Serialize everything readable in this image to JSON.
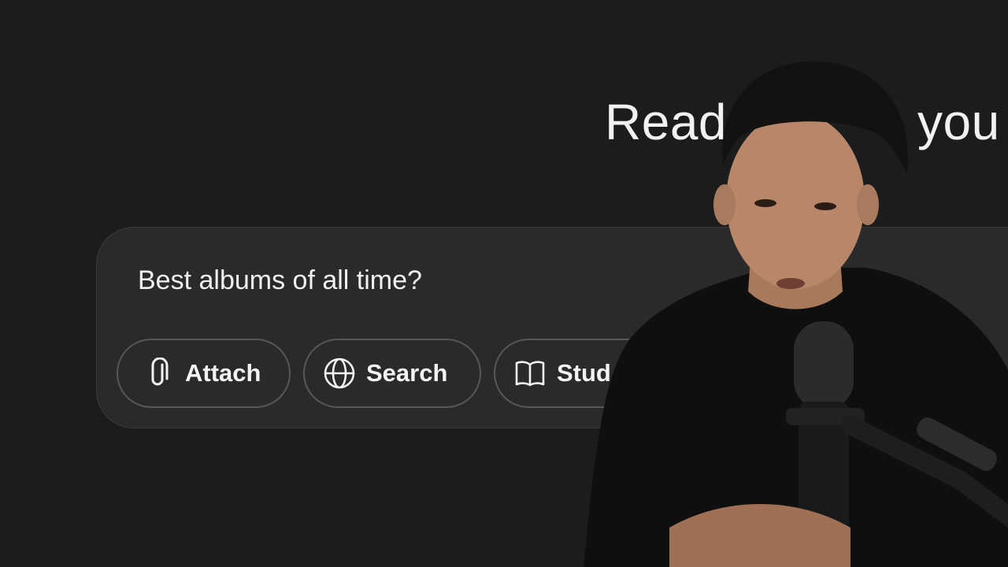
{
  "main": {
    "heading": "Read",
    "heading_tail": "you"
  },
  "composer": {
    "prompt_text": "Best albums of all time?",
    "chips": [
      {
        "label": "Attach",
        "icon": "paperclip-icon"
      },
      {
        "label": "Search",
        "icon": "globe-icon"
      },
      {
        "label": "Stud",
        "icon": "book-icon"
      }
    ]
  },
  "colors": {
    "background": "#1c1c1c",
    "composer": "#2a2a2a",
    "chip_border": "#575757",
    "text": "#f2f2f2"
  }
}
